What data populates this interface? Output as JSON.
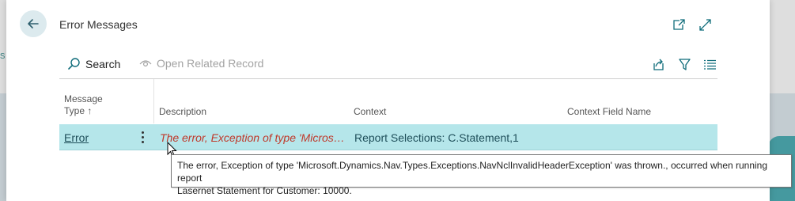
{
  "backdrop": {
    "side_letter": "s"
  },
  "header": {
    "title": "Error Messages",
    "back_icon": "arrow-left-icon",
    "open_new_window_icon": "open-new-window-icon",
    "expand_icon": "expand-icon"
  },
  "toolbar": {
    "search_label": "Search",
    "open_related_label": "Open Related Record",
    "share_icon": "share-icon",
    "filter_icon": "filter-icon",
    "list_icon": "list-view-icon"
  },
  "table": {
    "columns": {
      "message_type": "Message",
      "message_type_2": "Type ↑",
      "description": "Description",
      "context": "Context",
      "context_field_name": "Context Field Name"
    },
    "rows": [
      {
        "message_type": "Error",
        "description": "The error, Exception of type 'Microsoft....",
        "context": "Report Selections: C.Statement,1",
        "context_field_name": ""
      }
    ]
  },
  "tooltip": {
    "line1": "The error, Exception of type 'Microsoft.Dynamics.Nav.Types.Exceptions.NavNclInvalidHeaderException' was thrown., occurred when running report",
    "line2": "Lasernet Statement for Customer: 10000."
  },
  "colors": {
    "selected_row": "#b5e6ea",
    "error_text": "#c0392b",
    "accent": "#0f6c7a"
  }
}
